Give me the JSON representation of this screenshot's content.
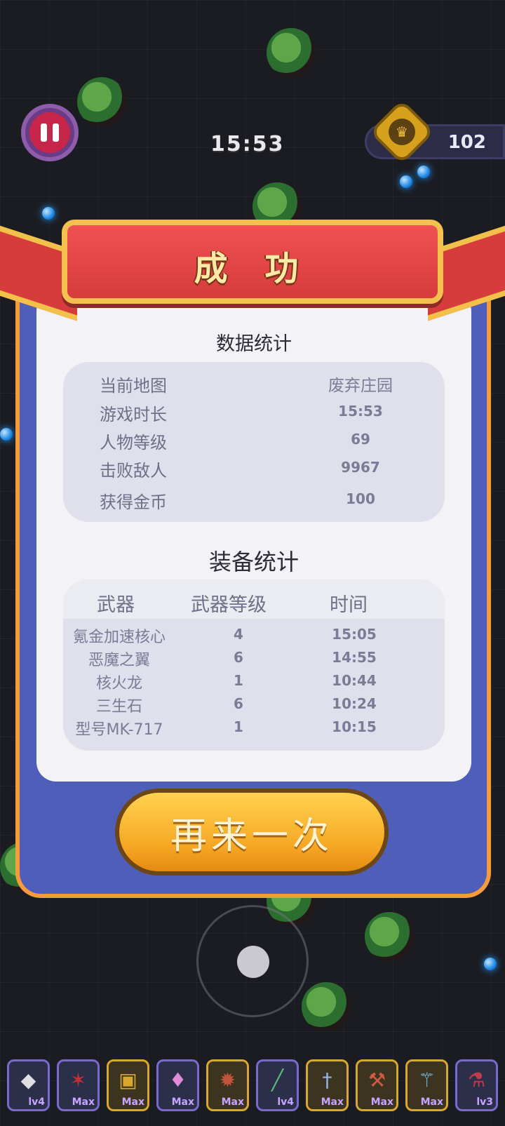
{
  "hud": {
    "timer": "15:53",
    "coins": "102"
  },
  "result": {
    "title": "成 功"
  },
  "stats": {
    "title": "数据统计",
    "rows": [
      {
        "label": "当前地图",
        "value": "废弃庄园"
      },
      {
        "label": "游戏时长",
        "value": "15:53"
      },
      {
        "label": "人物等级",
        "value": "69"
      },
      {
        "label": "击败敌人",
        "value": "9967"
      },
      {
        "label": "获得金币",
        "value": "100"
      }
    ]
  },
  "equipment": {
    "title": "装备统计",
    "headers": {
      "weapon": "武器",
      "level": "武器等级",
      "time": "时间"
    },
    "rows": [
      {
        "weapon": "氪金加速核心",
        "level": "4",
        "time": "15:05"
      },
      {
        "weapon": "恶魔之翼",
        "level": "6",
        "time": "14:55"
      },
      {
        "weapon": "核火龙",
        "level": "1",
        "time": "10:44"
      },
      {
        "weapon": "三生石",
        "level": "6",
        "time": "10:24"
      },
      {
        "weapon": "型号MK-717",
        "level": "1",
        "time": "10:15"
      }
    ]
  },
  "retry_button": "再来一次",
  "skills": [
    {
      "icon": "crystal-icon",
      "level": "lv4"
    },
    {
      "icon": "bat-icon",
      "level": "Max"
    },
    {
      "icon": "chest-icon",
      "level": "Max"
    },
    {
      "icon": "pink-crystal-icon",
      "level": "Max"
    },
    {
      "icon": "dragon-icon",
      "level": "Max"
    },
    {
      "icon": "rifle-icon",
      "level": "lv4"
    },
    {
      "icon": "sword-icon",
      "level": "Max"
    },
    {
      "icon": "axe-icon",
      "level": "Max"
    },
    {
      "icon": "staff-icon",
      "level": "Max"
    },
    {
      "icon": "potion-icon",
      "level": "lv3"
    }
  ]
}
